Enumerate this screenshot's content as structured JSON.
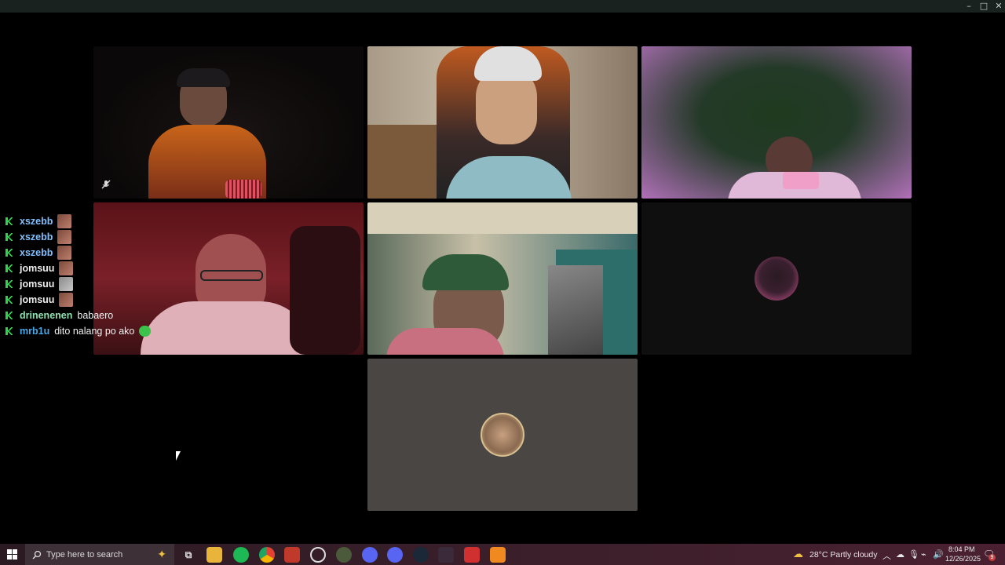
{
  "window": {
    "minimize": "–",
    "maximize": "□",
    "close": "✕"
  },
  "chat": [
    {
      "user": "xszebb",
      "color": "#7fc0ff",
      "message": "",
      "emote": "face-emote"
    },
    {
      "user": "xszebb",
      "color": "#7fc0ff",
      "message": "",
      "emote": "face-emote"
    },
    {
      "user": "xszebb",
      "color": "#7fc0ff",
      "message": "",
      "emote": "face-emote"
    },
    {
      "user": "jomsuu",
      "color": "#ededed",
      "message": "",
      "emote": "face-emote"
    },
    {
      "user": "jomsuu",
      "color": "#ededed",
      "message": "",
      "emote": "cat-emote"
    },
    {
      "user": "jomsuu",
      "color": "#ededed",
      "message": "",
      "emote": "face-emote"
    },
    {
      "user": "drinenenen",
      "color": "#8ee0b0",
      "message": "babaero",
      "emote": ""
    },
    {
      "user": "mrb1u",
      "color": "#4aa8e8",
      "message": "dito nalang po ako",
      "emote": "green-blob-emote"
    }
  ],
  "taskbar": {
    "search_placeholder": "Type here to search",
    "weather": "28°C  Partly cloudy",
    "time": "8:04 PM",
    "date": "12/26/2025",
    "notification_count": "9"
  }
}
